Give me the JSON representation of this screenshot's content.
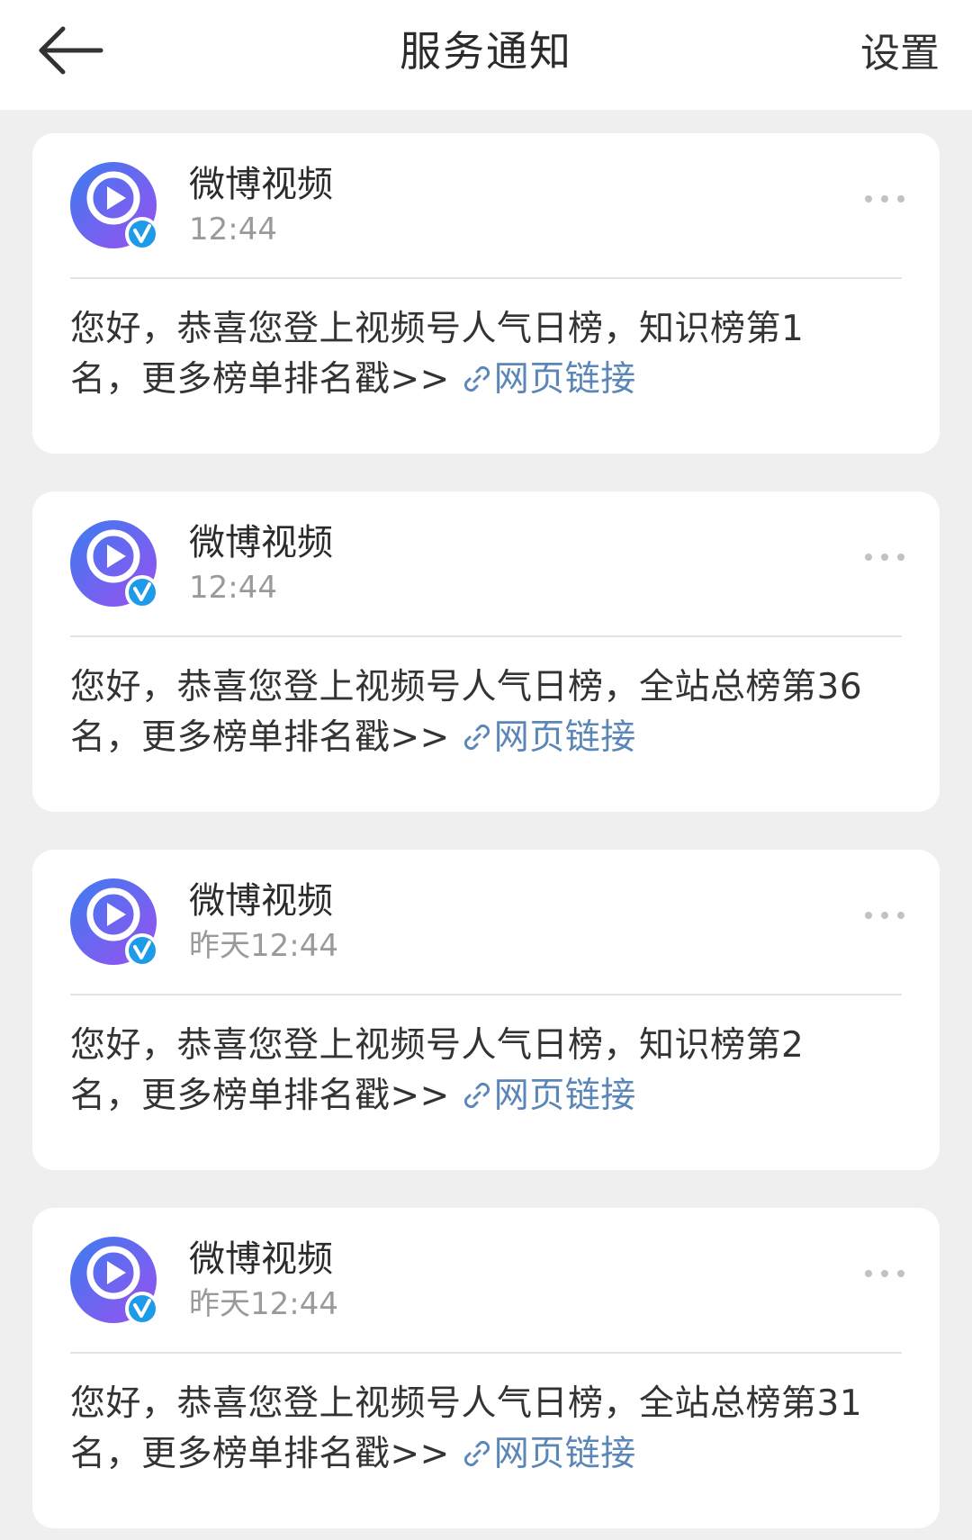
{
  "header": {
    "title": "服务通知",
    "settings_label": "设置"
  },
  "icons": {
    "back": "arrow-left-icon",
    "more": "ellipsis-icon",
    "link": "link-icon",
    "verified": "verified-badge-icon"
  },
  "colors": {
    "link": "#5a86b8",
    "verified_badge": "#1e9be8",
    "avatar_gradient_start": "#3c7df0",
    "avatar_gradient_end": "#9b4ff0"
  },
  "notifications": [
    {
      "sender": "微博视频",
      "time": "12:44",
      "message_line1": "您好，恭喜您登上视频号人气日榜，知识榜第1",
      "message_line2": "名，更多榜单排名戳>> ",
      "link_label": "网页链接"
    },
    {
      "sender": "微博视频",
      "time": "12:44",
      "message_line1": "您好，恭喜您登上视频号人气日榜，全站总榜第36",
      "message_line2": "名，更多榜单排名戳>> ",
      "link_label": "网页链接"
    },
    {
      "sender": "微博视频",
      "time": "昨天12:44",
      "message_line1": "您好，恭喜您登上视频号人气日榜，知识榜第2",
      "message_line2": "名，更多榜单排名戳>> ",
      "link_label": "网页链接"
    },
    {
      "sender": "微博视频",
      "time": "昨天12:44",
      "message_line1": "您好，恭喜您登上视频号人气日榜，全站总榜第31",
      "message_line2": "名，更多榜单排名戳>> ",
      "link_label": "网页链接"
    }
  ]
}
